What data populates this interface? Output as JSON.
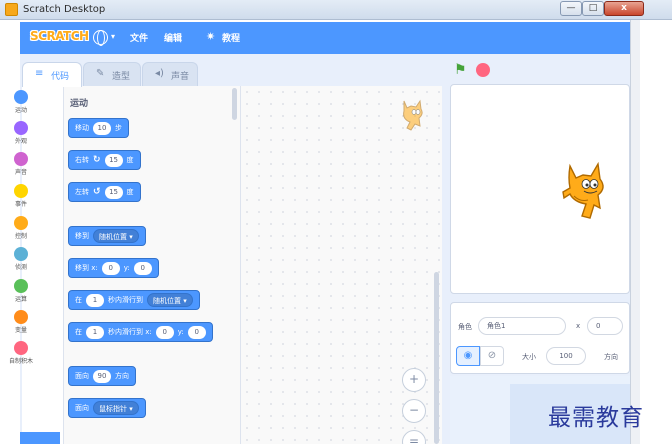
{
  "window": {
    "title": "Scratch Desktop",
    "min_glyph": "—",
    "max_glyph": "□",
    "close_glyph": "x"
  },
  "menubar": {
    "logo": "SCRATCH",
    "language_caret": "▾",
    "file": "文件",
    "edit": "编辑",
    "tutorials": "教程",
    "color": "#4c97ff"
  },
  "tabs": [
    {
      "label": "代码",
      "icon": "code-icon",
      "selected": true
    },
    {
      "label": "造型",
      "icon": "brush-icon",
      "selected": false
    },
    {
      "label": "声音",
      "icon": "speaker-icon",
      "selected": false
    }
  ],
  "categories": [
    {
      "label": "运动",
      "color": "#4c97ff"
    },
    {
      "label": "外观",
      "color": "#9966ff"
    },
    {
      "label": "声音",
      "color": "#cf63cf"
    },
    {
      "label": "事件",
      "color": "#ffd500"
    },
    {
      "label": "控制",
      "color": "#ffab19"
    },
    {
      "label": "侦测",
      "color": "#5cb1d6"
    },
    {
      "label": "运算",
      "color": "#59c059"
    },
    {
      "label": "变量",
      "color": "#ff8c1a"
    },
    {
      "label": "自制积木",
      "color": "#ff6680"
    }
  ],
  "palette": {
    "title": "运动",
    "blocks": {
      "move": {
        "pre": "移动",
        "value": "10",
        "post": "步"
      },
      "turn_right": {
        "pre": "右转",
        "icon": "↻",
        "value": "15",
        "post": "度"
      },
      "turn_left": {
        "pre": "左转",
        "icon": "↺",
        "value": "15",
        "post": "度"
      },
      "goto": {
        "pre": "移到",
        "dropdown": "随机位置 ▾"
      },
      "goto_xy": {
        "pre": "移到 x:",
        "x": "0",
        "ylabel": "y:",
        "y": "0"
      },
      "glide": {
        "pre": "在",
        "secs": "1",
        "mid": "秒内滑行到",
        "dropdown": "随机位置 ▾"
      },
      "glide_xy": {
        "pre": "在",
        "secs": "1",
        "mid": "秒内滑行到 x:",
        "x": "0",
        "ylabel": "y:",
        "y": "0"
      },
      "point_dir": {
        "pre": "面向",
        "value": "90",
        "post": "方向"
      },
      "point_towards": {
        "pre": "面向",
        "dropdown": "鼠标指针 ▾"
      }
    }
  },
  "zoom": {
    "in": "+",
    "out": "−",
    "reset": "="
  },
  "sprite_info": {
    "sprite_label": "角色",
    "sprite_name": "角色1",
    "x_label": "x",
    "x_value": "0",
    "show_label": "显示",
    "size_label": "大小",
    "size_value": "100",
    "direction_label": "方向"
  },
  "watermark": "最需教育"
}
